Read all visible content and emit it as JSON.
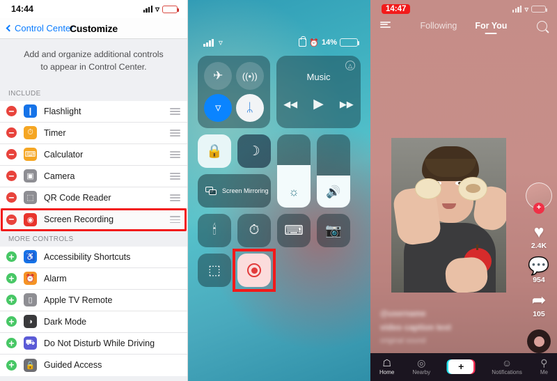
{
  "panels": {
    "settings": {
      "status": {
        "time": "14:44",
        "battery_low": true,
        "wifi_icon": "wifi-icon",
        "signal_icon": "cellular-signal-icon"
      },
      "nav": {
        "back_label": "Control Center",
        "title": "Customize"
      },
      "description": "Add and organize additional controls to appear in Control Center.",
      "sections": [
        {
          "header": "INCLUDE",
          "items": [
            {
              "label": "Flashlight",
              "action": "−",
              "action_type": "remove",
              "icon": "flashlight-icon",
              "glyph": "❘",
              "color": "#1673e8"
            },
            {
              "label": "Timer",
              "action": "−",
              "action_type": "remove",
              "icon": "timer-icon",
              "glyph": "⏱",
              "color": "#f5a623"
            },
            {
              "label": "Calculator",
              "action": "−",
              "action_type": "remove",
              "icon": "calculator-icon",
              "glyph": "⌸",
              "color": "#f5a623"
            },
            {
              "label": "Camera",
              "action": "−",
              "action_type": "remove",
              "icon": "camera-icon",
              "glyph": "▣",
              "color": "#8e8e93"
            },
            {
              "label": "QR Code Reader",
              "action": "−",
              "action_type": "remove",
              "icon": "qr-code-icon",
              "glyph": "⬚",
              "color": "#8e8e93"
            },
            {
              "label": "Screen Recording",
              "action": "−",
              "action_type": "remove",
              "icon": "screen-recording-icon",
              "glyph": "◉",
              "color": "#e8342c",
              "highlighted": true
            }
          ]
        },
        {
          "header": "MORE CONTROLS",
          "items": [
            {
              "label": "Accessibility Shortcuts",
              "action": "+",
              "action_type": "add",
              "icon": "accessibility-icon",
              "glyph": "♿",
              "color": "#1673e8"
            },
            {
              "label": "Alarm",
              "action": "+",
              "action_type": "add",
              "icon": "alarm-icon",
              "glyph": "⏰",
              "color": "#f59324"
            },
            {
              "label": "Apple TV Remote",
              "action": "+",
              "action_type": "add",
              "icon": "apple-tv-remote-icon",
              "glyph": "▯",
              "color": "#8e8e93"
            },
            {
              "label": "Dark Mode",
              "action": "+",
              "action_type": "add",
              "icon": "dark-mode-icon",
              "glyph": "◑",
              "color": "#3a3a3c"
            },
            {
              "label": "Do Not Disturb While Driving",
              "action": "+",
              "action_type": "add",
              "icon": "car-icon",
              "glyph": "⛟",
              "color": "#5b5bd6"
            },
            {
              "label": "Guided Access",
              "action": "+",
              "action_type": "add",
              "icon": "guided-access-icon",
              "glyph": "ὑ2",
              "color": "#6e6e73"
            }
          ]
        }
      ],
      "drag_handle_name": "reorder-handle"
    },
    "control_center": {
      "status": {
        "battery_percent": "14%",
        "battery_value": 14,
        "rotation_lock_icon": "rotation-lock-icon",
        "alarm_icon": "alarm-icon"
      },
      "connectivity": [
        {
          "name": "airplane-mode-toggle",
          "glyph": "✈",
          "state": "off"
        },
        {
          "name": "cellular-data-toggle",
          "glyph": "((•))",
          "state": "off"
        },
        {
          "name": "wifi-toggle",
          "glyph": "◠",
          "state": "on"
        },
        {
          "name": "bluetooth-toggle",
          "glyph": "ᛦ",
          "state": "on"
        }
      ],
      "music": {
        "title": "Music",
        "prev": "◀◀",
        "play": "▶",
        "next": "▶▶",
        "airplay_icon": "airplay-icon"
      },
      "tiles": [
        {
          "name": "orientation-lock-tile",
          "glyph": "ὑ2",
          "style": "light"
        },
        {
          "name": "do-not-disturb-tile",
          "glyph": "☽",
          "style": "dark"
        },
        {
          "name": "screen-mirroring-tile",
          "label": "Screen Mirroring"
        },
        {
          "name": "brightness-slider",
          "glyph": "☀",
          "fill_percent": 58
        },
        {
          "name": "volume-slider",
          "glyph": "ὐA",
          "fill_percent": 44
        },
        {
          "name": "flashlight-tile",
          "glyph": "ὒ6"
        },
        {
          "name": "timer-tile",
          "glyph": "⏱"
        },
        {
          "name": "calculator-tile",
          "glyph": "⌸"
        },
        {
          "name": "camera-tile",
          "glyph": "὏7"
        },
        {
          "name": "qr-code-tile",
          "glyph": "⬚"
        },
        {
          "name": "screen-recording-tile",
          "glyph": "◉",
          "highlighted": true
        }
      ]
    },
    "tiktok": {
      "status": {
        "time": "14:47",
        "recording_indicator": true
      },
      "top_nav": {
        "live_icon": "live-list-icon",
        "tabs": [
          "Following",
          "For You"
        ],
        "active_tab": "For You",
        "search_icon": "search-icon"
      },
      "actions": {
        "avatar_name": "creator-avatar",
        "follow_label": "+",
        "like": {
          "icon": "heart-icon",
          "glyph": "♥",
          "count": "2.4K"
        },
        "comment": {
          "icon": "comment-icon",
          "glyph": "ὊC",
          "count": "954"
        },
        "share": {
          "icon": "share-icon",
          "glyph": "➦",
          "count": "105"
        },
        "music_disc_name": "music-disc"
      },
      "caption": {
        "username": "@username",
        "text": "video caption text",
        "music": "original sound"
      },
      "tabbar": [
        {
          "label": "Home",
          "icon": "home-icon",
          "glyph": "⌂",
          "active": true
        },
        {
          "label": "Nearby",
          "icon": "location-pin-icon",
          "glyph": "◎",
          "active": false
        },
        {
          "label": "",
          "icon": "create-video-icon",
          "glyph": "+",
          "active": false
        },
        {
          "label": "Notifications",
          "icon": "inbox-icon",
          "glyph": "☺",
          "active": false
        },
        {
          "label": "Me",
          "icon": "profile-icon",
          "glyph": "⚲",
          "active": false
        }
      ]
    }
  },
  "colors": {
    "accent_blue": "#0a7cff",
    "remove_red": "#e8433c",
    "add_green": "#47c765",
    "highlight_red": "#f21a1a",
    "tiktok_pink": "#f03046"
  }
}
